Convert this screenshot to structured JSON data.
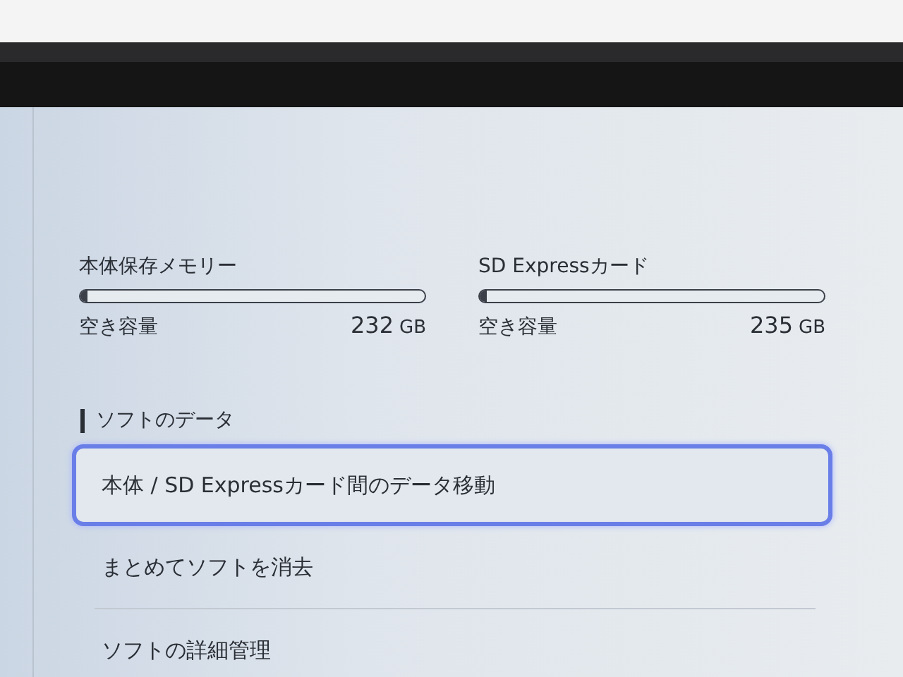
{
  "storage": [
    {
      "name": "本体保存メモリー",
      "level": 0.02,
      "free_label": "空き容量",
      "free_value": "232",
      "free_unit": "GB"
    },
    {
      "name": "SD Expressカード",
      "level": 0.02,
      "free_label": "空き容量",
      "free_value": "235",
      "free_unit": "GB"
    }
  ],
  "section": {
    "title": "ソフトのデータ"
  },
  "menu_items": [
    {
      "label": "本体 / SD Expressカード間のデータ移動",
      "selected": true
    },
    {
      "label": "まとめてソフトを消去",
      "selected": false
    },
    {
      "label": "ソフトの詳細管理",
      "selected": false
    }
  ]
}
